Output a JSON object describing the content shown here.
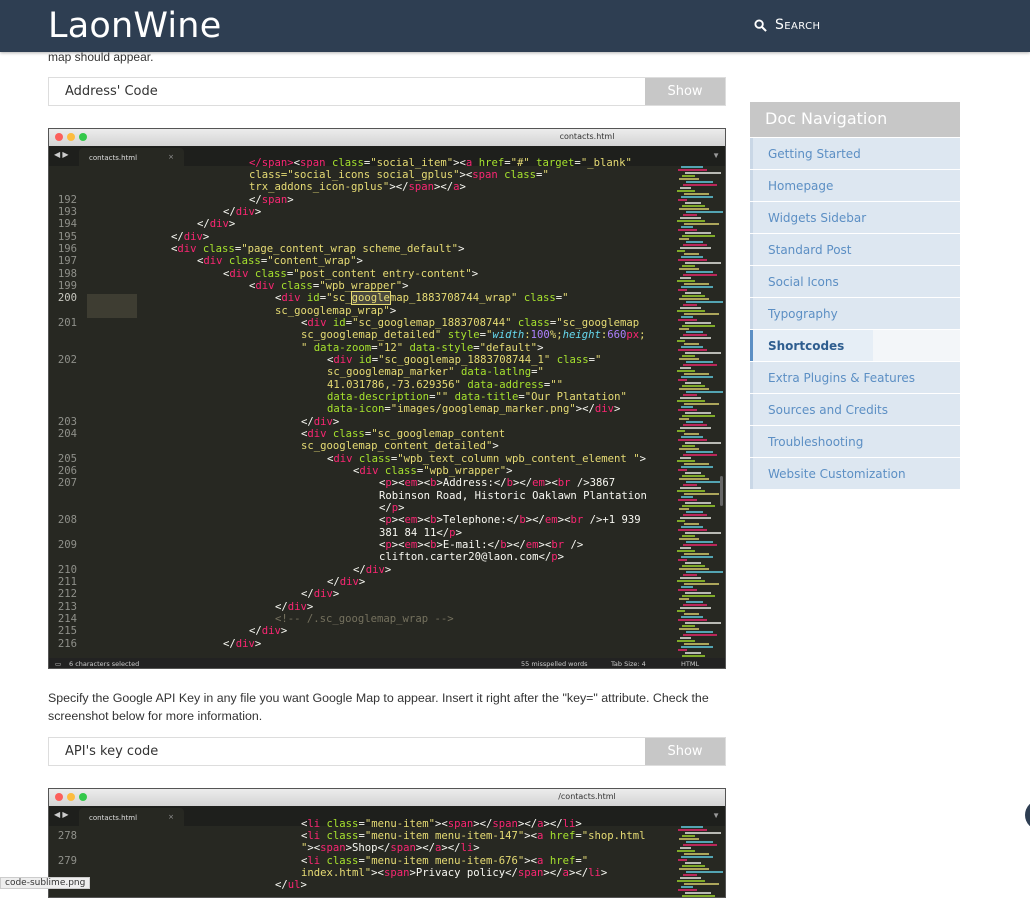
{
  "header": {
    "logo": "LaonWine",
    "search_label": "Search"
  },
  "intro_cut_text": "map should appear.",
  "address_box": {
    "label": "Address' Code",
    "button": "Show"
  },
  "editor1": {
    "title": "contacts.html",
    "tab": "contacts.html",
    "status_left": "6 characters selected",
    "status_words": "55 misspelled words",
    "status_tab": "Tab Size: 4",
    "status_lang": "HTML",
    "line_numbers": [
      "192",
      "193",
      "194",
      "195",
      "196",
      "197",
      "198",
      "199",
      "200",
      "201",
      "202",
      "203",
      "204",
      "205",
      "206",
      "207",
      "208",
      "209",
      "210",
      "211",
      "212",
      "213",
      "214",
      "215",
      "216"
    ]
  },
  "paragraph": "Specify the Google API Key in any file you want Google Map to appear. Insert it right after the \"key=\" attribute. Check the screenshot below for more information.",
  "api_box": {
    "label": "API's key code",
    "button": "Show"
  },
  "editor2": {
    "title": "/contacts.html",
    "tab": "contacts.html",
    "line_numbers": [
      "278",
      "279"
    ]
  },
  "sidebar": {
    "title": "Doc Navigation",
    "items": [
      "Getting Started",
      "Homepage",
      "Widgets Sidebar",
      "Standard Post",
      "Social Icons",
      "Typography",
      "Shortcodes",
      "Extra Plugins & Features",
      "Sources and Credits",
      "Troubleshooting",
      "Website Customization"
    ],
    "active_index": 6
  },
  "file_label": "code-sublime.png"
}
